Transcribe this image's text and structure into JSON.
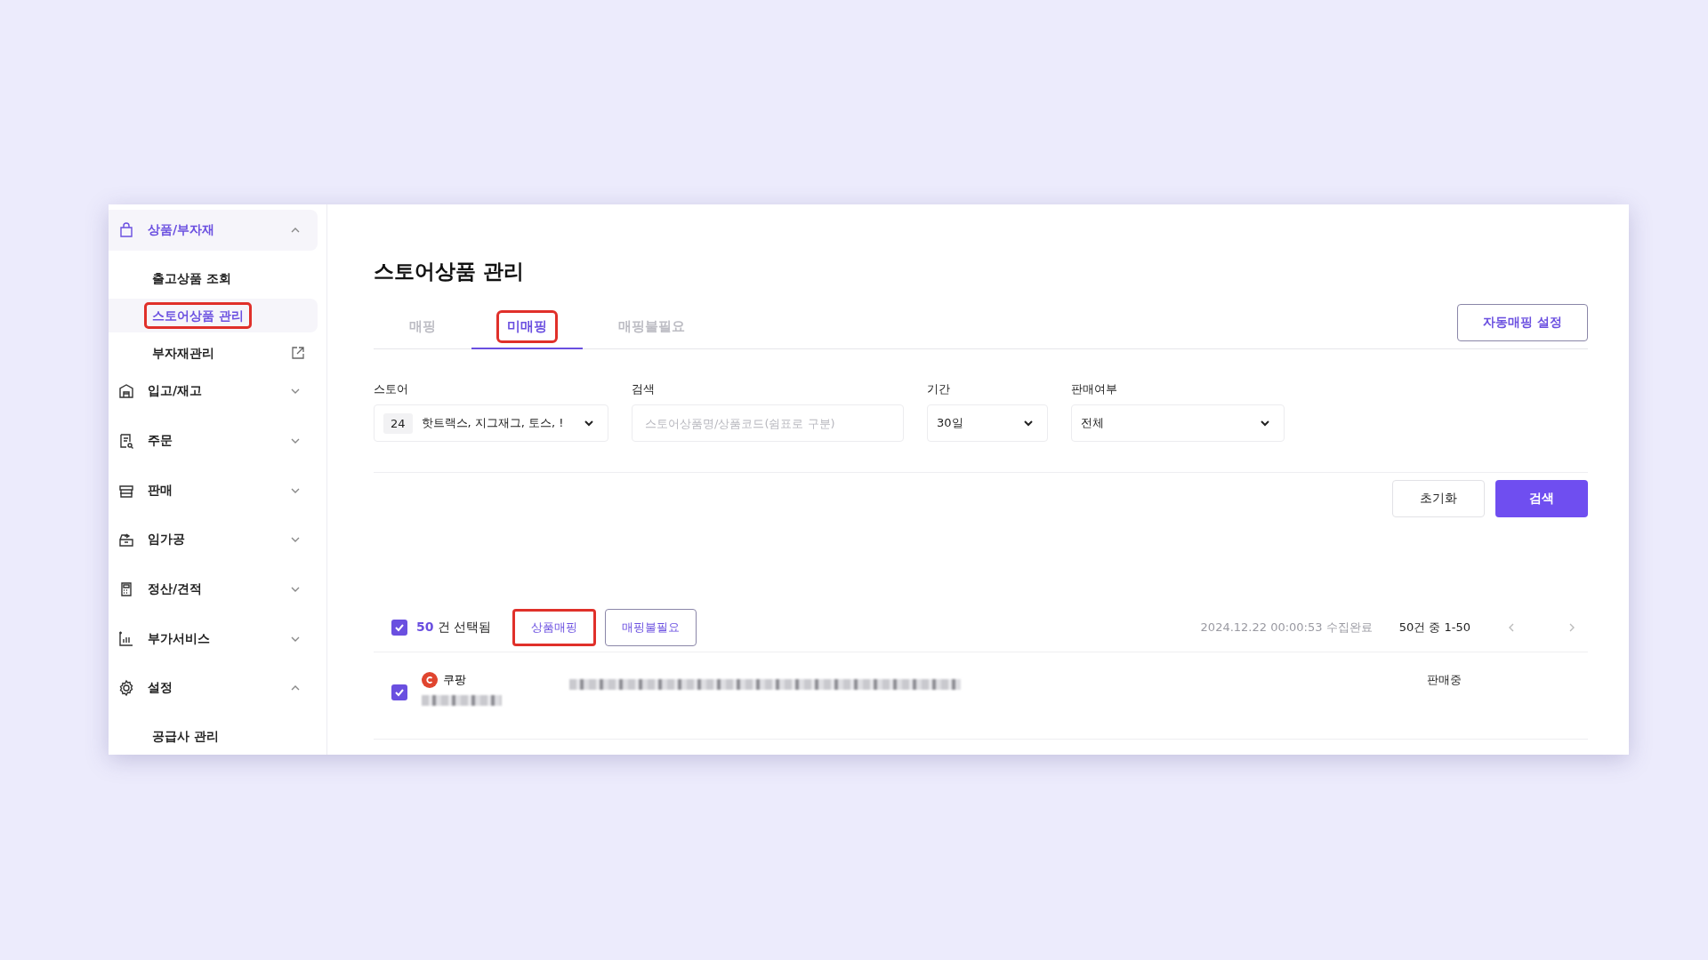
{
  "sidebar": {
    "groups": [
      {
        "label": "상품/부자재",
        "expanded": true,
        "selected": true,
        "children": [
          {
            "label": "출고상품 조회",
            "selected": false,
            "highlighted": false,
            "external": false
          },
          {
            "label": "스토어상품 관리",
            "selected": true,
            "highlighted": true,
            "external": false
          },
          {
            "label": "부자재관리",
            "selected": false,
            "highlighted": false,
            "external": true
          }
        ]
      },
      {
        "label": "입고/재고",
        "expanded": false,
        "selected": false
      },
      {
        "label": "주문",
        "expanded": false,
        "selected": false
      },
      {
        "label": "판매",
        "expanded": false,
        "selected": false
      },
      {
        "label": "임가공",
        "expanded": false,
        "selected": false
      },
      {
        "label": "정산/견적",
        "expanded": false,
        "selected": false
      },
      {
        "label": "부가서비스",
        "expanded": false,
        "selected": false
      },
      {
        "label": "설정",
        "expanded": true,
        "selected": false,
        "children": [
          {
            "label": "공급사 관리",
            "selected": false,
            "highlighted": false,
            "external": false
          }
        ]
      }
    ]
  },
  "page": {
    "title": "스토어상품 관리",
    "tabs": [
      {
        "label": "매핑",
        "selected": false,
        "highlighted": false
      },
      {
        "label": "미매핑",
        "selected": true,
        "highlighted": true
      },
      {
        "label": "매핑불필요",
        "selected": false,
        "highlighted": false
      }
    ],
    "auto_mapping_button": "자동매핑 설정",
    "filters": {
      "store": {
        "label": "스토어",
        "count": "24",
        "value": "핫트랙스, 지그재그, 토스, !"
      },
      "search": {
        "label": "검색",
        "placeholder": "스토어상품명/상품코드(쉼표로 구분)"
      },
      "period": {
        "label": "기간",
        "value": "30일"
      },
      "sale_status": {
        "label": "판매여부",
        "value": "전체"
      }
    },
    "reset_button": "초기화",
    "search_button": "검색",
    "selection": {
      "checked": true,
      "count": "50",
      "text": "건 선택됨"
    },
    "actions": [
      {
        "label": "상품매핑",
        "highlighted": true
      },
      {
        "label": "매핑불필요",
        "highlighted": false
      }
    ],
    "collected_at": "2024.12.22 00:00:53 수집완료",
    "pagination": "50건 중 1-50",
    "rows": [
      {
        "checked": true,
        "store": "쿠팡",
        "status": "판매중"
      }
    ]
  }
}
